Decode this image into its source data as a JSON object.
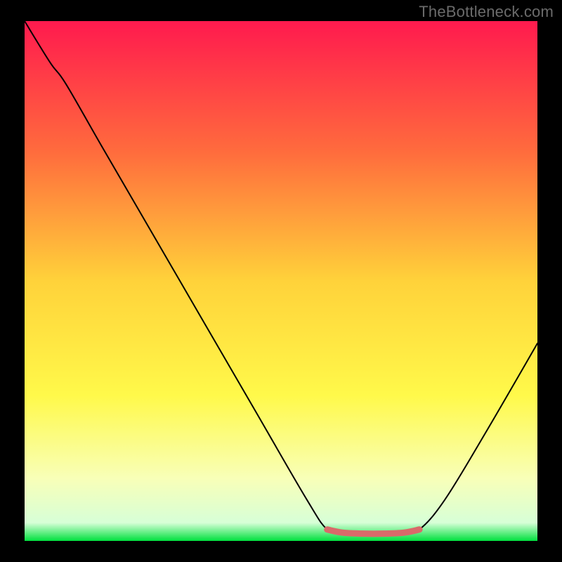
{
  "watermark": "TheBottleneck.com",
  "chart_data": {
    "type": "line",
    "title": "",
    "xlabel": "",
    "ylabel": "",
    "xlim": [
      0,
      100
    ],
    "ylim": [
      0,
      100
    ],
    "grid": false,
    "legend": false,
    "series": [
      {
        "name": "curve",
        "color": "#000000",
        "stroke_width": 2,
        "points": [
          {
            "x": 0,
            "y": 100
          },
          {
            "x": 5,
            "y": 92
          },
          {
            "x": 8,
            "y": 88
          },
          {
            "x": 15,
            "y": 76
          },
          {
            "x": 25,
            "y": 59
          },
          {
            "x": 35,
            "y": 42
          },
          {
            "x": 45,
            "y": 25
          },
          {
            "x": 55,
            "y": 8
          },
          {
            "x": 59,
            "y": 2.2
          },
          {
            "x": 62,
            "y": 1.6
          },
          {
            "x": 66,
            "y": 1.4
          },
          {
            "x": 70,
            "y": 1.4
          },
          {
            "x": 74,
            "y": 1.6
          },
          {
            "x": 77,
            "y": 2.2
          },
          {
            "x": 82,
            "y": 8
          },
          {
            "x": 90,
            "y": 21
          },
          {
            "x": 100,
            "y": 38
          }
        ]
      },
      {
        "name": "trough-highlight",
        "color": "#d96a6a",
        "stroke_width": 9,
        "points": [
          {
            "x": 59,
            "y": 2.2
          },
          {
            "x": 62,
            "y": 1.6
          },
          {
            "x": 66,
            "y": 1.4
          },
          {
            "x": 70,
            "y": 1.4
          },
          {
            "x": 74,
            "y": 1.6
          },
          {
            "x": 77,
            "y": 2.2
          }
        ]
      }
    ],
    "background": {
      "type": "gradient-over-band",
      "gradient_stops": [
        {
          "offset": 0.0,
          "color": "#ff1a4e"
        },
        {
          "offset": 0.25,
          "color": "#ff6b3d"
        },
        {
          "offset": 0.5,
          "color": "#ffd23a"
        },
        {
          "offset": 0.72,
          "color": "#fff94a"
        },
        {
          "offset": 0.88,
          "color": "#f8ffb8"
        },
        {
          "offset": 0.965,
          "color": "#d7ffd7"
        },
        {
          "offset": 1.0,
          "color": "#00e03e"
        }
      ]
    }
  }
}
